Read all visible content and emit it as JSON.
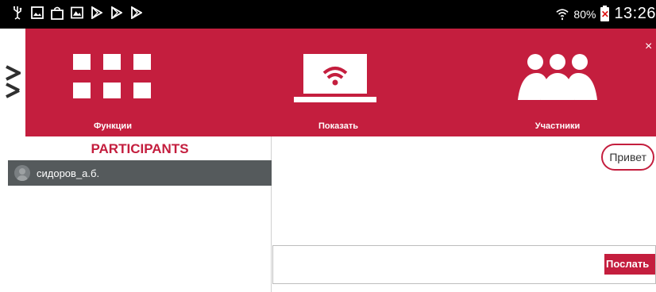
{
  "status_bar": {
    "left_icons": [
      "usb-icon",
      "image-icon",
      "bag-icon",
      "gallery-icon",
      "play-store-icon",
      "play-store-icon",
      "play-store-icon"
    ],
    "battery_percent": "80%",
    "time": "13:26"
  },
  "menu": {
    "items": [
      {
        "label": "Функции",
        "icon": "grid-icon"
      },
      {
        "label": "Показать",
        "icon": "laptop-wifi-icon"
      },
      {
        "label": "Участники",
        "icon": "people-icon"
      }
    ],
    "close_glyph": "×"
  },
  "sidebar": {
    "title": "PARTICIPANTS",
    "participants": [
      {
        "name": "сидоров_а.б."
      }
    ]
  },
  "chat": {
    "messages": [
      {
        "text": "Привет"
      }
    ],
    "input_value": "",
    "send_label": "Послать"
  },
  "colors": {
    "accent": "#c41e3e",
    "participant_row": "#555a5c",
    "status_bar": "#000000"
  }
}
